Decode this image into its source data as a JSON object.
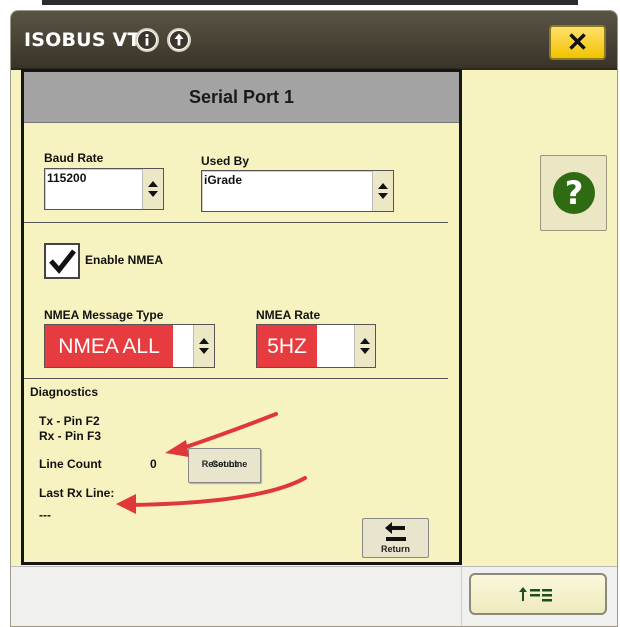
{
  "window": {
    "title": "ISOBUS VT",
    "close_label": "✕"
  },
  "panel": {
    "header": "Serial Port 1",
    "baud_rate": {
      "label": "Baud Rate",
      "value": "115200"
    },
    "used_by": {
      "label": "Used By",
      "value": "iGrade"
    },
    "enable_nmea": {
      "label": "Enable NMEA",
      "checked": true
    },
    "nmea_message_type": {
      "label": "NMEA Message Type",
      "value": "NMEA ALL"
    },
    "nmea_rate": {
      "label": "NMEA Rate",
      "value": "5HZ"
    },
    "diagnostics": {
      "heading": "Diagnostics",
      "tx": "Tx - Pin F2",
      "rx": "Rx - Pin F3",
      "line_count_label": "Line Count",
      "line_count_value": "0",
      "reset_label_line1": "Reset Line",
      "reset_label_line2": "Count",
      "last_rx_label": "Last Rx Line:",
      "last_rx_value": "---"
    },
    "return_label": "Return"
  },
  "sidebar": {
    "help_icon": "question-icon"
  },
  "colors": {
    "accent_red": "#e73c3f",
    "panel_bg": "#f7f3c0",
    "close_yellow": "#f2c300",
    "help_green": "#2f6b12",
    "annotation_arrow": "#e03838"
  }
}
